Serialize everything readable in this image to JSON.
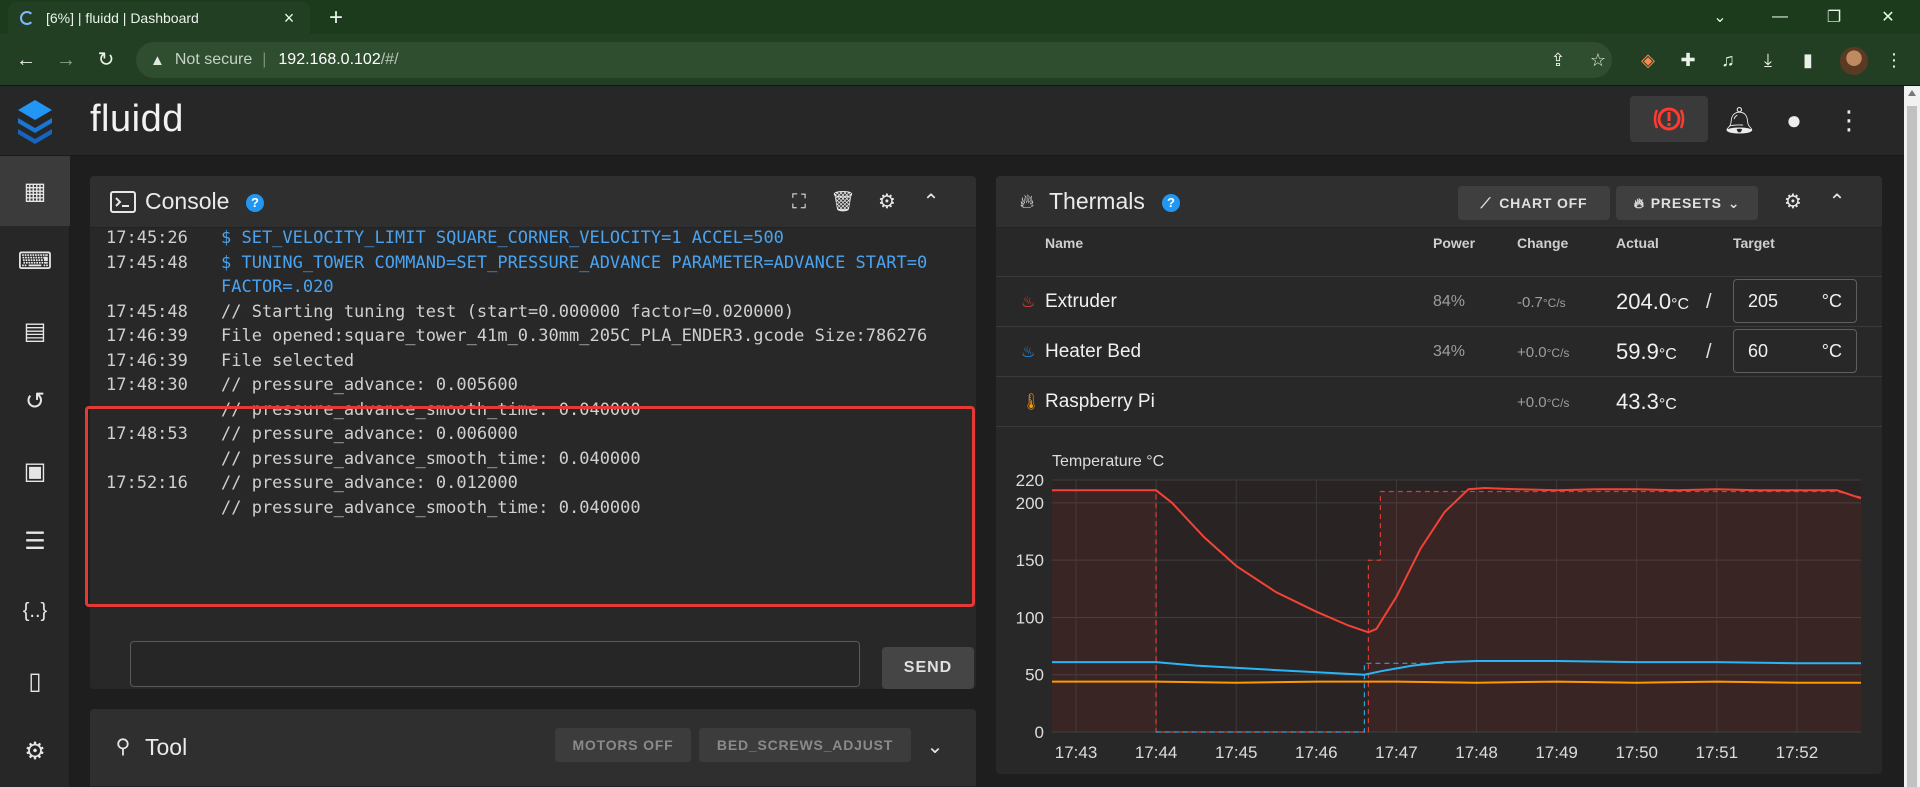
{
  "browser": {
    "tab_title": "[6%] | fluidd | Dashboard",
    "not_secure": "Not secure",
    "url_host": "192.168.0.102",
    "url_path": "/#/"
  },
  "app": {
    "name": "fluidd"
  },
  "console": {
    "title": "Console",
    "lines": [
      {
        "time": "17:45:26",
        "text": "$ SET_VELOCITY_LIMIT SQUARE_CORNER_VELOCITY=1 ACCEL=500",
        "kind": "cmd"
      },
      {
        "time": "17:45:48",
        "text": "$ TUNING_TOWER COMMAND=SET_PRESSURE_ADVANCE PARAMETER=ADVANCE START=0",
        "kind": "cmd"
      },
      {
        "time": "",
        "text": "FACTOR=.020",
        "kind": "cmd"
      },
      {
        "time": "17:45:48",
        "text": "// Starting tuning test (start=0.000000 factor=0.020000)",
        "kind": "resp"
      },
      {
        "time": "17:46:39",
        "text": "File opened:square_tower_41m_0.30mm_205C_PLA_ENDER3.gcode Size:786276",
        "kind": "resp"
      },
      {
        "time": "17:46:39",
        "text": "File selected",
        "kind": "resp"
      },
      {
        "time": "17:48:30",
        "text": "// pressure_advance: 0.005600",
        "kind": "resp"
      },
      {
        "time": "",
        "text": "// pressure_advance_smooth_time: 0.040000",
        "kind": "resp"
      },
      {
        "time": "17:48:53",
        "text": "// pressure_advance: 0.006000",
        "kind": "resp"
      },
      {
        "time": "",
        "text": "// pressure_advance_smooth_time: 0.040000",
        "kind": "resp"
      },
      {
        "time": "17:52:16",
        "text": "// pressure_advance: 0.012000",
        "kind": "resp"
      },
      {
        "time": "",
        "text": "// pressure_advance_smooth_time: 0.040000",
        "kind": "resp"
      }
    ],
    "input_value": "",
    "send_label": "SEND"
  },
  "tool": {
    "title": "Tool",
    "motors_off": "MOTORS OFF",
    "bed_screws": "BED_SCREWS_ADJUST"
  },
  "thermals": {
    "title": "Thermals",
    "chart_off": "CHART OFF",
    "presets": "PRESETS",
    "headers": {
      "name": "Name",
      "power": "Power",
      "change": "Change",
      "actual": "Actual",
      "target": "Target"
    },
    "rows": [
      {
        "name": "Extruder",
        "power": "84%",
        "change": "-0.7",
        "change_unit": "°C/s",
        "actual": "204.0",
        "actual_unit": "°C",
        "target": "205",
        "target_unit": "°C",
        "color": "#f44336"
      },
      {
        "name": "Heater Bed",
        "power": "34%",
        "change": "+0.0",
        "change_unit": "°C/s",
        "actual": "59.9",
        "actual_unit": "°C",
        "target": "60",
        "target_unit": "°C",
        "color": "#2196f3"
      },
      {
        "name": "Raspberry Pi",
        "power": "",
        "change": "+0.0",
        "change_unit": "°C/s",
        "actual": "43.3",
        "actual_unit": "°C",
        "target": "",
        "target_unit": "",
        "color": "#ff9800"
      }
    ]
  },
  "chart_data": {
    "type": "line",
    "title": "Temperature °C",
    "x_ticks": [
      "17:43",
      "17:44",
      "17:45",
      "17:46",
      "17:47",
      "17:48",
      "17:49",
      "17:50",
      "17:51",
      "17:52"
    ],
    "y_ticks": [
      0,
      50,
      100,
      150,
      200,
      220
    ],
    "ylim": [
      0,
      220
    ],
    "xlim_minutes": [
      42.7,
      52.8
    ],
    "grid": true,
    "series": [
      {
        "name": "Extruder",
        "color": "#f44336",
        "kind": "actual",
        "x": [
          42.7,
          43.5,
          44.0,
          44.2,
          44.6,
          45.0,
          45.5,
          46.0,
          46.4,
          46.65,
          46.75,
          47.0,
          47.3,
          47.6,
          47.9,
          48.1,
          48.5,
          49.0,
          49.5,
          50.0,
          50.5,
          51.0,
          51.5,
          52.0,
          52.5,
          52.8
        ],
        "y": [
          211,
          211,
          211,
          200,
          170,
          145,
          122,
          105,
          93,
          87,
          90,
          118,
          160,
          192,
          212,
          213,
          212,
          211,
          212,
          212,
          211,
          212,
          211,
          211,
          211,
          204
        ]
      },
      {
        "name": "Extruder",
        "color": "#f44336",
        "kind": "target",
        "x": [
          42.7,
          44.0,
          44.0,
          46.65,
          46.65,
          46.8,
          46.8,
          52.5,
          52.8
        ],
        "y": [
          211,
          211,
          0,
          0,
          150,
          150,
          210,
          210,
          205
        ]
      },
      {
        "name": "Heater Bed",
        "color": "#29b6f6",
        "kind": "actual",
        "x": [
          42.7,
          44.0,
          44.5,
          45.5,
          46.6,
          46.8,
          47.2,
          47.6,
          48.0,
          49.0,
          50.0,
          51.0,
          52.0,
          52.8
        ],
        "y": [
          61,
          61,
          58,
          54,
          50,
          53,
          58,
          61,
          62,
          62,
          61,
          61,
          60,
          60
        ]
      },
      {
        "name": "Heater Bed",
        "color": "#29b6f6",
        "kind": "target",
        "x": [
          44.0,
          46.6,
          46.6,
          47.6
        ],
        "y": [
          0,
          0,
          60,
          60
        ]
      },
      {
        "name": "Raspberry Pi",
        "color": "#ff9800",
        "kind": "actual",
        "x": [
          42.7,
          44.0,
          45.0,
          46.0,
          47.0,
          48.0,
          49.0,
          50.0,
          51.0,
          52.0,
          52.8
        ],
        "y": [
          44,
          44,
          43,
          44,
          44,
          43,
          44,
          43,
          44,
          43,
          43
        ]
      }
    ]
  }
}
